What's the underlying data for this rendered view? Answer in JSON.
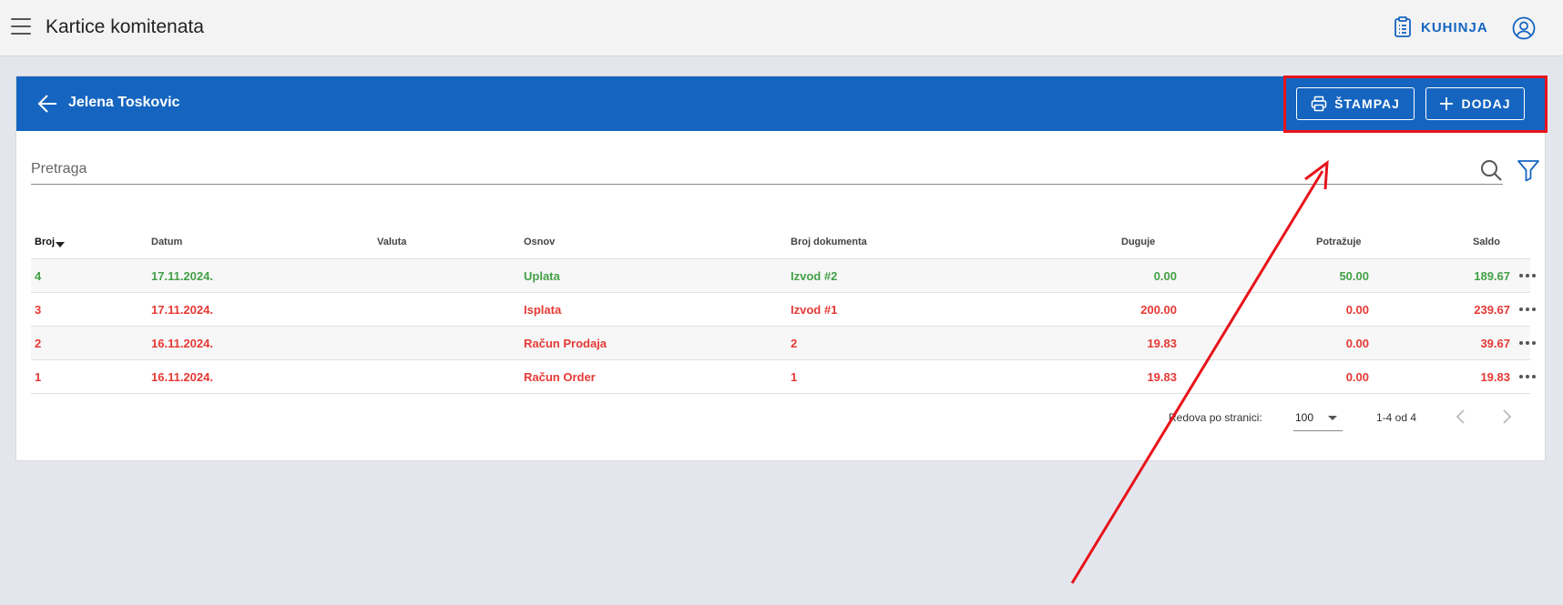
{
  "appbar": {
    "title": "Kartice komitenata",
    "kitchen_label": "KUHINJA"
  },
  "card": {
    "partner_name": "Jelena Toskovic",
    "print_label": "ŠTAMPAJ",
    "add_label": "DODAJ",
    "search_placeholder": "Pretraga"
  },
  "table": {
    "columns": [
      "Broj",
      "Datum",
      "Valuta",
      "Osnov",
      "Broj dokumenta",
      "Duguje",
      "Potražuje",
      "Saldo"
    ],
    "rows": [
      {
        "broj": "4",
        "datum": "17.11.2024.",
        "valuta": "",
        "osnov": "Uplata",
        "dokument": "Izvod #2",
        "duguje": "0.00",
        "potrazuje": "50.00",
        "saldo": "189.67",
        "color": "#43a047"
      },
      {
        "broj": "3",
        "datum": "17.11.2024.",
        "valuta": "",
        "osnov": "Isplata",
        "dokument": "Izvod #1",
        "duguje": "200.00",
        "potrazuje": "0.00",
        "saldo": "239.67",
        "color": "#e53935"
      },
      {
        "broj": "2",
        "datum": "16.11.2024.",
        "valuta": "",
        "osnov": "Račun Prodaja",
        "dokument": "2",
        "duguje": "19.83",
        "potrazuje": "0.00",
        "saldo": "39.67",
        "color": "#e53935"
      },
      {
        "broj": "1",
        "datum": "16.11.2024.",
        "valuta": "",
        "osnov": "Račun Order",
        "dokument": "1",
        "duguje": "19.83",
        "potrazuje": "0.00",
        "saldo": "19.83",
        "color": "#e53935"
      }
    ]
  },
  "pagination": {
    "rows_per_page_label": "Redova po stranici:",
    "rows_per_page_value": "100",
    "range": "1-4 od 4"
  },
  "colors": {
    "primary": "#1565c0",
    "income": "#43a047",
    "expense": "#e53935",
    "annotation": "#e8131b"
  }
}
